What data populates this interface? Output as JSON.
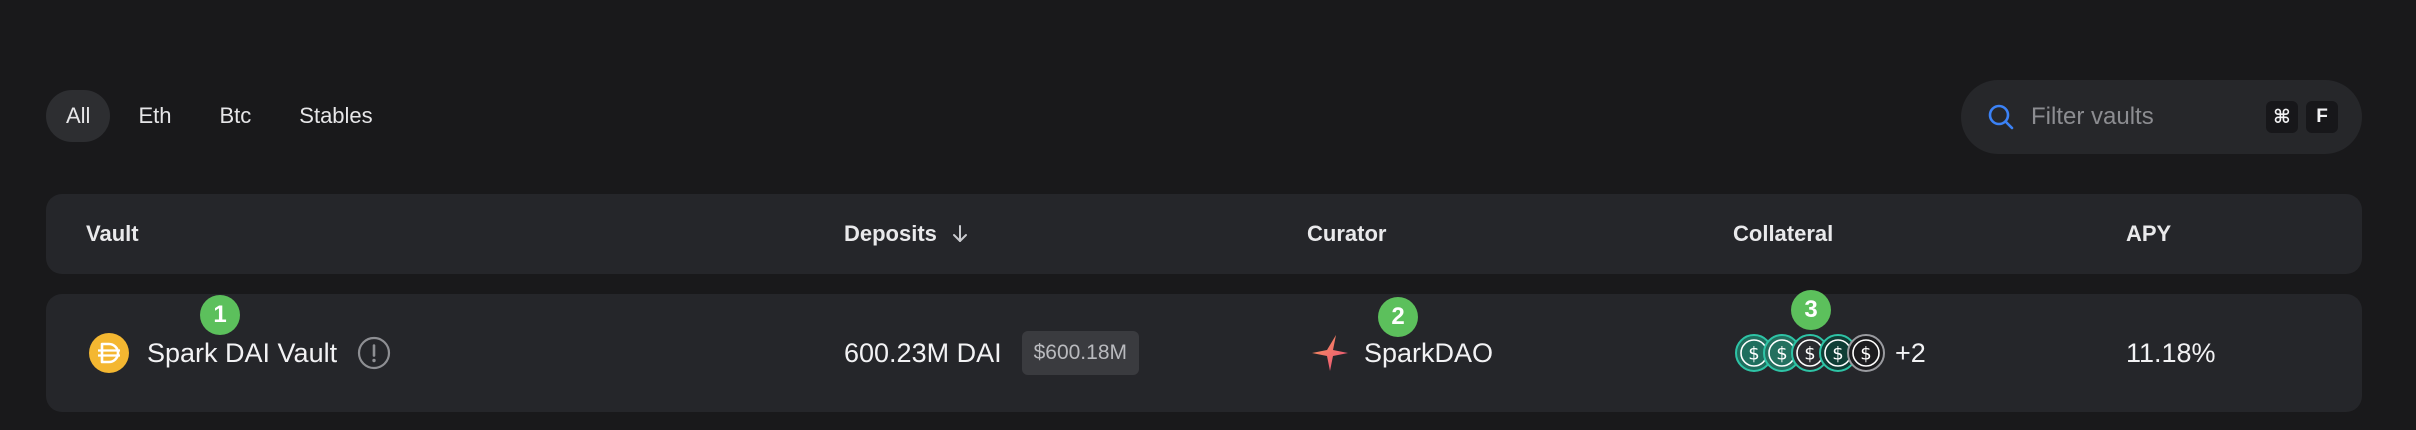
{
  "filters": {
    "tabs": [
      {
        "label": "All",
        "active": true
      },
      {
        "label": "Eth",
        "active": false
      },
      {
        "label": "Btc",
        "active": false
      },
      {
        "label": "Stables",
        "active": false
      }
    ]
  },
  "search": {
    "placeholder": "Filter vaults",
    "value": "",
    "shortcut_modifier": "⌘",
    "shortcut_key": "F"
  },
  "table": {
    "headers": {
      "vault": "Vault",
      "deposits": "Deposits",
      "curator": "Curator",
      "collateral": "Collateral",
      "apy": "APY"
    },
    "sort": {
      "column": "deposits",
      "direction": "descending"
    },
    "rows": [
      {
        "vault_name": "Spark DAI Vault",
        "deposit_amount": "600.23M DAI",
        "deposit_usd": "$600.18M",
        "curator": "SparkDAO",
        "collateral_extra": "+2",
        "apy": "11.18%"
      }
    ]
  },
  "markers": [
    "1",
    "2",
    "3"
  ],
  "colors": {
    "background": "#19191b",
    "surface": "#25262a",
    "accent_blue": "#3b82f6",
    "marker_green": "#5cc05c",
    "dai_orange": "#f4b731",
    "coin_teal": "#2ec4a6"
  },
  "icons": {
    "search": "search-icon",
    "sort": "arrow-down-icon",
    "info": "info-icon",
    "vault_token": "dai-token-icon",
    "curator_logo": "spark-star-icon",
    "collateral_coins": [
      "dollar-coin-icon",
      "dollar-coin-icon",
      "dollar-coin-icon",
      "dollar-coin-icon",
      "dollar-coin-icon"
    ]
  }
}
